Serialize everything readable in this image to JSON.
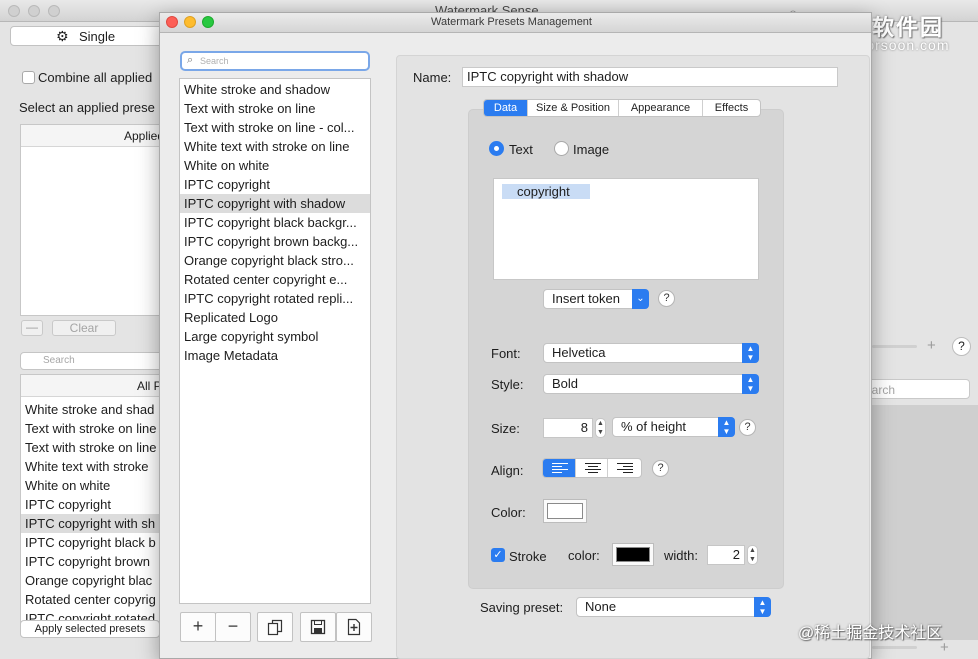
{
  "background_window": {
    "title": "Watermark Sense",
    "mode_label": "Single",
    "combine_label": "Combine all applied",
    "select_label": "Select an applied prese",
    "applied_header": "Applied",
    "minus_label": "—",
    "clear_label": "Clear",
    "search_placeholder": "Search",
    "all_presets_header": "All P",
    "presets": [
      "White stroke and shad",
      "Text with stroke on line",
      "Text with stroke on line",
      "White text with stroke",
      "White on white",
      "IPTC copyright",
      "IPTC copyright with sh",
      "IPTC copyright black b",
      "IPTC copyright brown",
      "Orange copyright blac",
      "Rotated center copyrig",
      "IPTC copyright rotated"
    ],
    "selected_preset_index": 6,
    "apply_label": "Apply selected presets",
    "right_search_placeholder": "earch",
    "right_plus": "+",
    "right_help": "?"
  },
  "dialog": {
    "title": "Watermark Presets Management",
    "search_placeholder": "Search",
    "presets": [
      "White stroke and shadow",
      "Text with stroke on line",
      "Text with stroke on line - col...",
      "White text with stroke on line",
      "White on white",
      "IPTC copyright",
      "IPTC copyright with shadow",
      "IPTC copyright black backgr...",
      "IPTC copyright brown backg...",
      "Orange copyright black stro...",
      "Rotated center copyright e...",
      "IPTC copyright rotated repli...",
      "Replicated Logo",
      "Large copyright symbol",
      "Image Metadata"
    ],
    "selected_index": 6,
    "toolbar": {
      "add_icon": "+",
      "remove_icon": "−"
    },
    "name_label": "Name:",
    "name_value": "IPTC copyright with shadow",
    "tabs": [
      "Data",
      "Size & Position",
      "Appearance",
      "Effects"
    ],
    "active_tab": 0,
    "radio_text_label": "Text",
    "radio_image_label": "Image",
    "token_text": "copyright",
    "insert_token_label": "Insert token",
    "help_glyph": "?",
    "font_label": "Font:",
    "font_value": "Helvetica",
    "style_label": "Style:",
    "style_value": "Bold",
    "size_label": "Size:",
    "size_value": "8",
    "size_unit": "% of height",
    "align_label": "Align:",
    "align_selected": "left",
    "color_label": "Color:",
    "color_value": "#ffffff",
    "stroke_label": "Stroke",
    "stroke_checked": true,
    "stroke_color_label": "color:",
    "stroke_color_value": "#000000",
    "stroke_width_label": "width:",
    "stroke_width_value": "2",
    "saving_label": "Saving preset:",
    "saving_value": "None"
  },
  "watermarks": {
    "top_line1": "未来软件园",
    "top_line2": "mac.orsoon.com",
    "bottom": "@稀土掘金技术社区"
  },
  "colors": {
    "accent": "#2b7cf0",
    "selection": "#dcdcdc",
    "token_highlight": "#c9dcf5"
  }
}
